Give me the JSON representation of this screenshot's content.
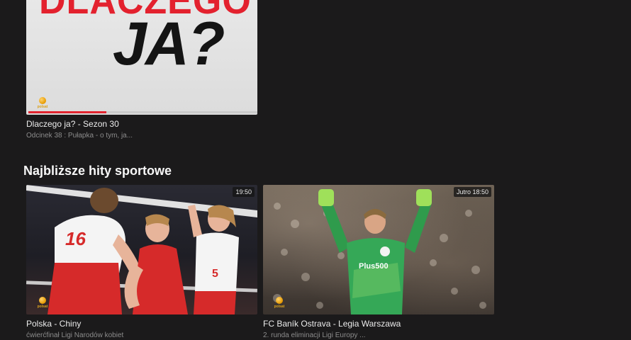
{
  "row1": {
    "card": {
      "title": "Dlaczego ja? - Sezon 30",
      "subtitle": "Odcinek 38 : Pułapka - o tym, ja...",
      "art_line1": "DLACZEGO",
      "art_line2": "JA?",
      "progress": 0.34,
      "channel_logo": "polsat"
    }
  },
  "section": {
    "title": "Najbliższe hity sportowe"
  },
  "sport_cards": [
    {
      "title": "Polska - Chiny",
      "subtitle": "ćwierćfinał Ligi Narodów kobiet",
      "time": "19:50",
      "channel_logo": "polsat"
    },
    {
      "title": "FC Baník Ostrava - Legia Warszawa",
      "subtitle": "2. runda eliminacji Ligi Europy ...",
      "time": "Jutro 18:50",
      "channel_logo": "polsat",
      "jersey_sponsor": "Plus500"
    }
  ],
  "colors": {
    "background": "#1b1a1b",
    "accent": "#e2242f",
    "logo": "#e79a00"
  }
}
